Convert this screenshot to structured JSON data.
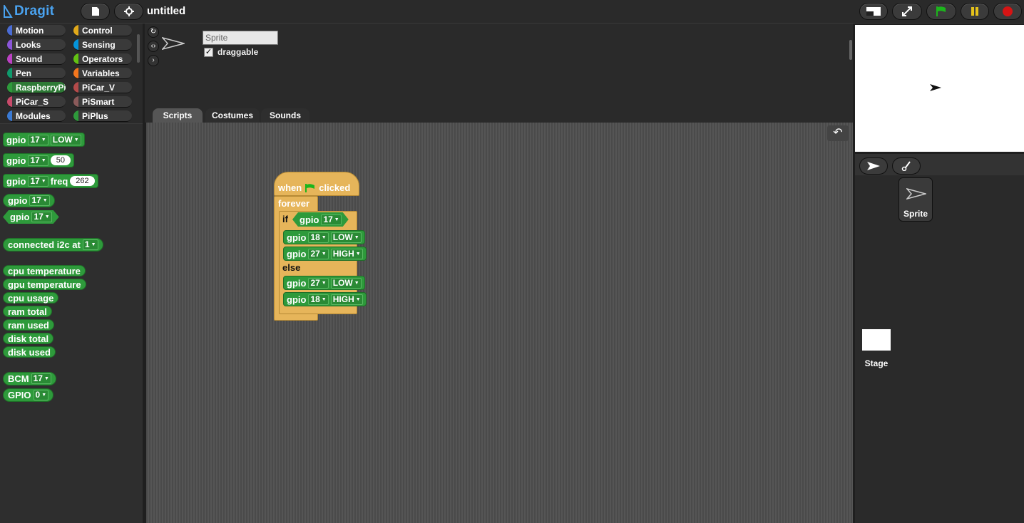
{
  "app": {
    "logo_text": "Dragit",
    "project_title": "untitled",
    "icons": [
      "file-icon",
      "gear-icon",
      "stage-size-icon",
      "fullscreen-icon",
      "green-flag-icon",
      "pause-icon",
      "stop-icon"
    ]
  },
  "categories": [
    {
      "label": "Motion",
      "color": "#4a6cd4"
    },
    {
      "label": "Control",
      "color": "#e1a91a"
    },
    {
      "label": "Looks",
      "color": "#8a55d7"
    },
    {
      "label": "Sensing",
      "color": "#0494dc"
    },
    {
      "label": "Sound",
      "color": "#bb42c3"
    },
    {
      "label": "Operators",
      "color": "#62c213"
    },
    {
      "label": "Pen",
      "color": "#0e9a6c"
    },
    {
      "label": "Variables",
      "color": "#f3761d"
    },
    {
      "label": "RaspberryPi",
      "color": "#2e9a3b"
    },
    {
      "label": "PiCar_V",
      "color": "#b44a4a"
    },
    {
      "label": "PiCar_S",
      "color": "#c84a6a"
    },
    {
      "label": "PiSmart",
      "color": "#8a5a5a"
    },
    {
      "label": "Modules",
      "color": "#3a7ad4"
    },
    {
      "label": "PiPlus",
      "color": "#2e9a3b"
    }
  ],
  "palette": {
    "gpio_word": "gpio",
    "freq_word": "freq",
    "pin": "17",
    "low": "LOW",
    "pwm": "50",
    "freq": "262",
    "i2c_label": "connected i2c at",
    "i2c_value": "1",
    "reporters": [
      "cpu temperature",
      "gpu temperature",
      "cpu usage",
      "ram total",
      "ram used",
      "disk total",
      "disk used"
    ],
    "bcm_label": "BCM",
    "bcm_value": "17",
    "gpio_caps": "GPIO",
    "gpio_caps_value": "0"
  },
  "sprite": {
    "name": "Sprite",
    "draggable_label": "draggable",
    "draggable_checked": "✓"
  },
  "tabs": [
    "Scripts",
    "Costumes",
    "Sounds"
  ],
  "script": {
    "when": "when",
    "clicked": "clicked",
    "forever": "forever",
    "if": "if",
    "else": "else",
    "gpio": "gpio",
    "cond_pin": "17",
    "then_rows": [
      {
        "pin": "18",
        "value": "LOW"
      },
      {
        "pin": "27",
        "value": "HIGH"
      }
    ],
    "else_rows": [
      {
        "pin": "27",
        "value": "LOW"
      },
      {
        "pin": "18",
        "value": "HIGH"
      }
    ]
  },
  "corral": {
    "sprite_label": "Sprite",
    "stage_label": "Stage"
  }
}
